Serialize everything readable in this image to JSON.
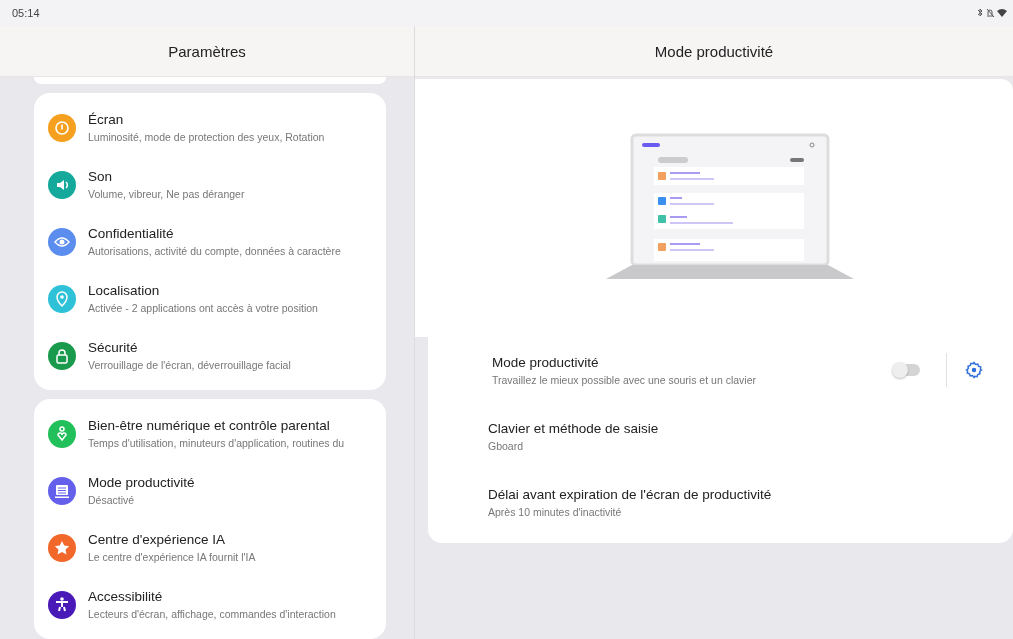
{
  "status_bar": {
    "time": "05:14"
  },
  "left_pane": {
    "title": "Paramètres",
    "groups": [
      {
        "items": [
          {
            "title": "Écran",
            "subtitle": "Luminosité, mode de protection des yeux, Rotation",
            "color": "#f5a01f"
          },
          {
            "title": "Son",
            "subtitle": "Volume, vibreur, Ne pas déranger",
            "color": "#14a99a"
          },
          {
            "title": "Confidentialité",
            "subtitle": "Autorisations, activité du compte, données à caractère",
            "color": "#5b8def"
          },
          {
            "title": "Localisation",
            "subtitle": "Activée - 2 applications ont accès à votre position",
            "color": "#2fc1d8"
          },
          {
            "title": "Sécurité",
            "subtitle": "Verrouillage de l'écran, déverrouillage facial",
            "color": "#1a9a4c"
          }
        ]
      },
      {
        "items": [
          {
            "title": "Bien-être numérique et contrôle parental",
            "subtitle": "Temps d'utilisation, minuteurs d'application, routines du",
            "color": "#22c05a"
          },
          {
            "title": "Mode productivité",
            "subtitle": "Désactivé",
            "color": "#6460ec"
          },
          {
            "title": "Centre d'expérience IA",
            "subtitle": "Le centre d'expérience IA fournit l'IA",
            "color": "#f2682a"
          },
          {
            "title": "Accessibilité",
            "subtitle": "Lecteurs d'écran, affichage, commandes d'interaction",
            "color": "#4a1ab8"
          }
        ]
      }
    ]
  },
  "right_pane": {
    "title": "Mode productivité",
    "rows": [
      {
        "kind": "toggle",
        "title": "Mode productivité",
        "subtitle": "Travaillez le mieux possible avec une souris et un clavier",
        "on": false
      },
      {
        "kind": "plain",
        "title": "Clavier et méthode de saisie",
        "subtitle": "Gboard"
      },
      {
        "kind": "plain",
        "title": "Délai avant expiration de l'écran de productivité",
        "subtitle": "Après 10 minutes d'inactivité"
      }
    ]
  }
}
